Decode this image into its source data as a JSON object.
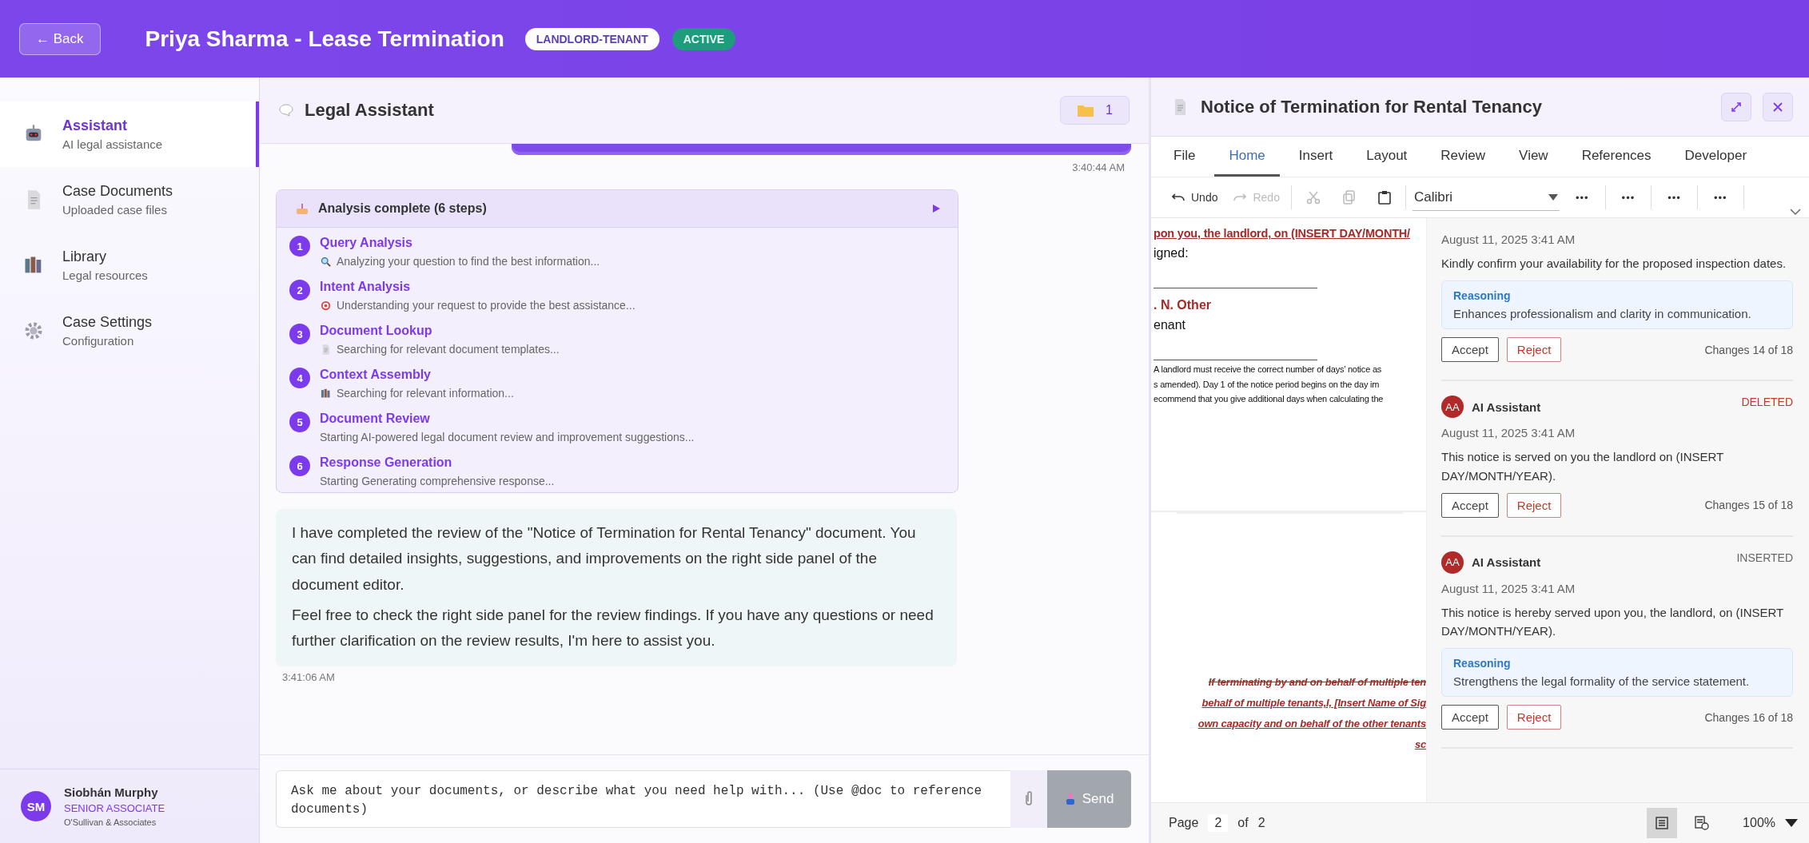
{
  "header": {
    "back_label": "← Back",
    "title": "Priya Sharma - Lease Termination",
    "badges": [
      {
        "label": "LANDLORD-TENANT",
        "kind": "category"
      },
      {
        "label": "ACTIVE",
        "kind": "status"
      }
    ]
  },
  "sidebar": {
    "items": [
      {
        "title": "Assistant",
        "subtitle": "AI legal assistance",
        "selected": true
      },
      {
        "title": "Case Documents",
        "subtitle": "Uploaded case files",
        "selected": false
      },
      {
        "title": "Library",
        "subtitle": "Legal resources",
        "selected": false
      },
      {
        "title": "Case Settings",
        "subtitle": "Configuration",
        "selected": false
      }
    ],
    "user": {
      "initials": "SM",
      "name": "Siobhán Murphy",
      "role": "SENIOR ASSOCIATE",
      "firm": "O'Sullivan & Associates"
    }
  },
  "chat": {
    "title": "Legal Assistant",
    "folder_count": "1",
    "user_message_time": "3:40:44 AM",
    "analysis": {
      "title": "Analysis complete (6 steps)",
      "expanded": true,
      "steps": [
        {
          "number": "1",
          "title": "Query Analysis",
          "detail": "Analyzing your question to find the best information..."
        },
        {
          "number": "2",
          "title": "Intent Analysis",
          "detail": "Understanding your request to provide the best assistance..."
        },
        {
          "number": "3",
          "title": "Document Lookup",
          "detail": "Searching for relevant document templates..."
        },
        {
          "number": "4",
          "title": "Context Assembly",
          "detail": "Searching for relevant information..."
        },
        {
          "number": "5",
          "title": "Document Review",
          "detail": "Starting AI-powered legal document review and improvement suggestions..."
        },
        {
          "number": "6",
          "title": "Response Generation",
          "detail": "Starting Generating comprehensive response..."
        }
      ]
    },
    "response": {
      "paragraphs": [
        "I have completed the review of the \"Notice of Termination for Rental Tenancy\" document. You can find detailed insights, suggestions, and improvements on the right side panel of the document editor.",
        "Feel free to check the right side panel for the review findings. If you have any questions or need further clarification on the review results, I'm here to assist you."
      ],
      "time": "3:41:06 AM"
    },
    "input": {
      "placeholder": "Ask me about your documents, or describe what you need help with... (Use @doc to reference documents)",
      "send_label": "Send"
    }
  },
  "document": {
    "title": "Notice of Termination for Rental Tenancy",
    "menu_tabs": [
      {
        "label": "File",
        "selected": false
      },
      {
        "label": "Home",
        "selected": true
      },
      {
        "label": "Insert",
        "selected": false
      },
      {
        "label": "Layout",
        "selected": false
      },
      {
        "label": "Review",
        "selected": false
      },
      {
        "label": "View",
        "selected": false
      },
      {
        "label": "References",
        "selected": false
      },
      {
        "label": "Developer",
        "selected": false
      }
    ],
    "toolbar": {
      "undo": {
        "label": "Undo",
        "disabled": false
      },
      "redo": {
        "label": "Redo",
        "disabled": true
      },
      "cut_disabled": true,
      "copy_disabled": true,
      "font": "Calibri",
      "more_buttons": [
        "•••",
        "•••",
        "•••",
        "•••"
      ]
    },
    "page_lines": [
      {
        "text": "pon you, the landlord, on (INSERT DAY/MONTH/",
        "kind": "inserted"
      },
      {
        "text": "igned:",
        "kind": "normal"
      },
      {
        "kind": "rule"
      },
      {
        "text": ". N. Other",
        "kind": "name"
      },
      {
        "text": "enant",
        "kind": "normal"
      },
      {
        "kind": "rule"
      },
      {
        "text": "A landlord must receive the correct number of days’ notice as",
        "kind": "small"
      },
      {
        "text": "s amended). Day 1 of the notice period begins on the day im",
        "kind": "small"
      },
      {
        "text": "ecommend that you give additional days when calculating the",
        "kind": "small"
      },
      {
        "kind": "page-break"
      },
      {
        "text": "If terminating by and on behalf of multiple ten",
        "kind": "deleted"
      },
      {
        "text": "behalf of multiple tenants,I, [Insert Name of Sig",
        "kind": "inserted-italic"
      },
      {
        "text": "own capacity and on behalf of the other tenants",
        "kind": "inserted-italic"
      },
      {
        "text": "sc",
        "kind": "inserted-italic"
      }
    ],
    "changes": [
      {
        "date": "August 11, 2025 3:41 AM",
        "text": "Kindly confirm your availability for the proposed inspection dates.",
        "reasoning_label": "Reasoning",
        "reasoning": "Enhances professionalism and clarity in communication.",
        "accept": "Accept",
        "reject": "Reject",
        "counter": "Changes 14 of 18"
      },
      {
        "author": "AI Assistant",
        "initials": "AA",
        "change_type": "DELETED",
        "date": "August 11, 2025 3:41 AM",
        "text": "This notice is served on you the landlord on (INSERT DAY/MONTH/YEAR).",
        "accept": "Accept",
        "reject": "Reject",
        "counter": "Changes 15 of 18"
      },
      {
        "author": "AI Assistant",
        "initials": "AA",
        "change_type": "INSERTED",
        "date": "August 11, 2025 3:41 AM",
        "text": "This notice is hereby served upon you, the landlord, on (INSERT DAY/MONTH/YEAR).",
        "reasoning_label": "Reasoning",
        "reasoning": "Strengthens the legal formality of the service statement.",
        "accept": "Accept",
        "reject": "Reject",
        "counter": "Changes 16 of 18"
      }
    ],
    "status": {
      "page_label": "Page",
      "page": "2",
      "of_label": "of",
      "total": "2",
      "views": [
        {
          "kind": "print",
          "selected": true
        },
        {
          "kind": "web",
          "selected": false
        }
      ],
      "zoom": "100%"
    }
  }
}
